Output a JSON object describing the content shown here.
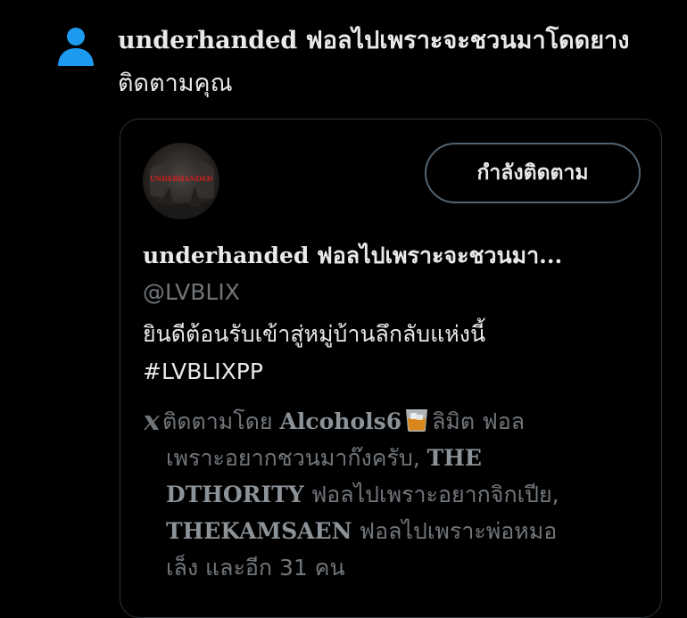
{
  "notification": {
    "icon": "person-icon",
    "icon_color": "#1d9bf0",
    "actor_name": "underhanded ฟอลไปเพราะจะชวนมาโดดยาง",
    "action_text": "ติดตามคุณ"
  },
  "card": {
    "avatar_text": "UNDERHANDED",
    "follow_button_label": "กำลังติดตาม",
    "display_name": "underhanded ฟอลไปเพราะจะชวนมา...",
    "handle": "@LVBLIX",
    "bio_line1": "ยินดีต้อนรับเข้าสู่หมู่บ้านลึกลับแห่งนี้",
    "bio_line2": "#LVBLIXPP",
    "followed_by": {
      "prefix": "ติดตามโดย",
      "follower1_name": "Alcohols6",
      "follower1_suffix": "ลิมิต ฟอล",
      "follower1_rest": "เพราะอยากชวนมาก๊งครับ,",
      "follower2_name_a": "THE",
      "follower2_name_b": "DTHORITY",
      "follower2_suffix": "ฟอลไปเพราะอยากจิกเปีย,",
      "follower3_name": "THEKAMSAEN",
      "follower3_suffix": "ฟอลไปเพราะพ่อหมอ",
      "tail": "เล็ง และอีก 31 คน"
    }
  },
  "colors": {
    "background": "#000000",
    "text_primary": "#e7e9ea",
    "text_secondary": "#71767b",
    "border": "#2f3336",
    "accent": "#1d9bf0"
  }
}
